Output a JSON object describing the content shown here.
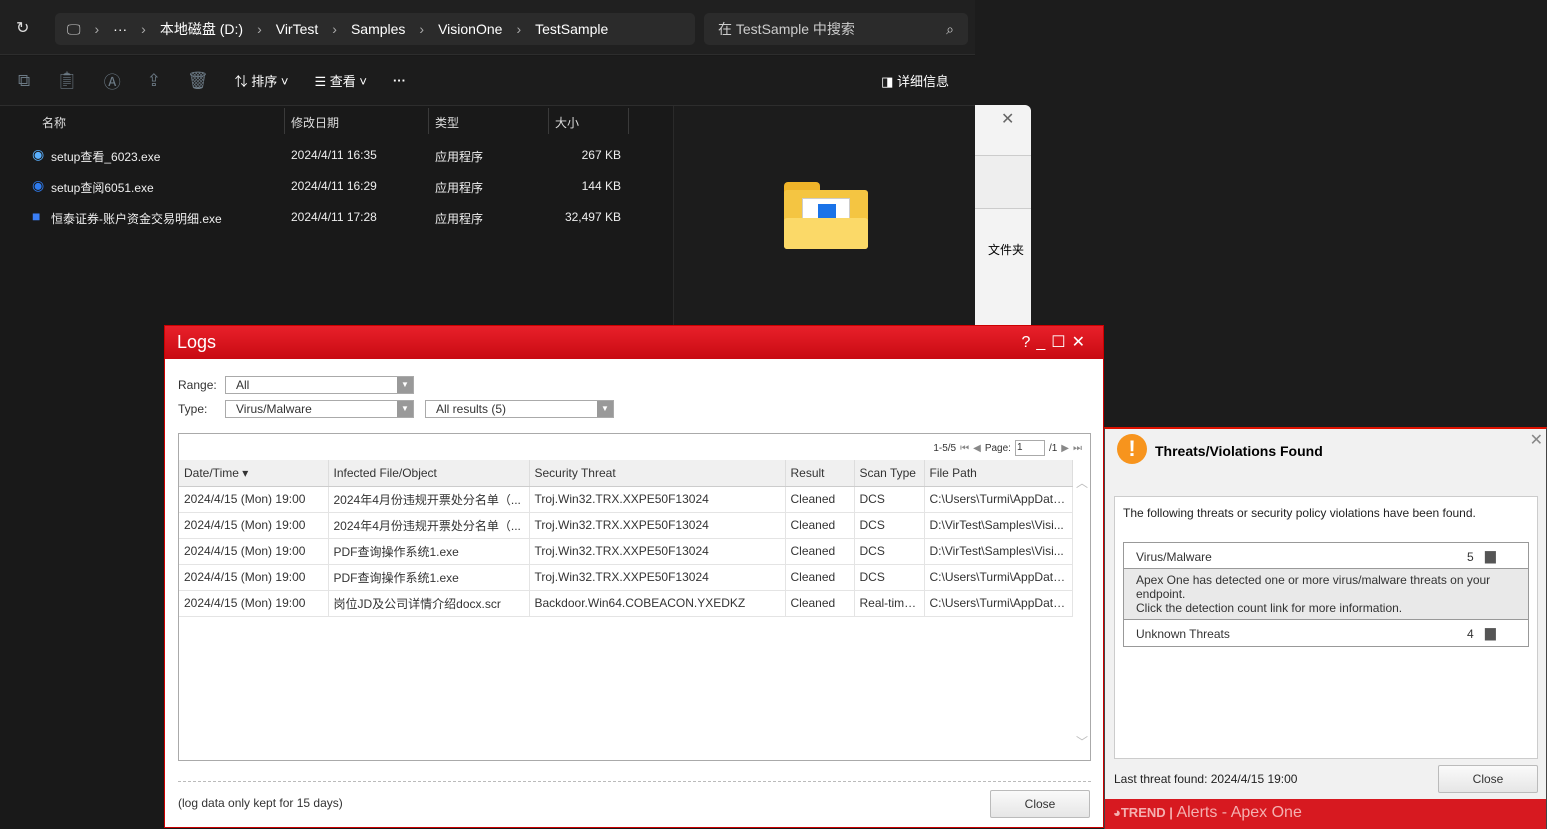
{
  "explorer": {
    "breadcrumb": [
      "本地磁盘 (D:)",
      "VirTest",
      "Samples",
      "VisionOne",
      "TestSample"
    ],
    "more": "···",
    "search_placeholder": "在 TestSample 中搜索",
    "toolbar": {
      "sort": "排序",
      "view": "查看",
      "more": "···",
      "details": "详细信息"
    },
    "columns": [
      "名称",
      "修改日期",
      "类型",
      "大小"
    ],
    "files": [
      {
        "name": "setup查看_6023.exe",
        "date": "2024/4/11 16:35",
        "type": "应用程序",
        "size": "267 KB"
      },
      {
        "name": "setup查阅6051.exe",
        "date": "2024/4/11 16:29",
        "type": "应用程序",
        "size": "144 KB"
      },
      {
        "name": "恒泰证券-账户资金交易明细.exe",
        "date": "2024/4/11 17:28",
        "type": "应用程序",
        "size": "32,497 KB"
      }
    ],
    "side_window_label": "文件夹"
  },
  "logs": {
    "title": "Logs",
    "range_label": "Range:",
    "range_value": "All",
    "type_label": "Type:",
    "type_value": "Virus/Malware",
    "results_value": "All results (5)",
    "pager": {
      "count": "1-5/5",
      "page_label": "Page:",
      "page": "1",
      "total": "/1"
    },
    "columns": [
      "Date/Time ▾",
      "Infected File/Object",
      "Security Threat",
      "Result",
      "Scan Type",
      "File Path"
    ],
    "rows": [
      [
        "2024/4/15 (Mon) 19:00",
        "2024年4月份违规开票处分名单（...",
        "Troj.Win32.TRX.XXPE50F13024",
        "Cleaned",
        "DCS",
        "C:\\Users\\Turmi\\AppData..."
      ],
      [
        "2024/4/15 (Mon) 19:00",
        "2024年4月份违规开票处分名单（...",
        "Troj.Win32.TRX.XXPE50F13024",
        "Cleaned",
        "DCS",
        "D:\\VirTest\\Samples\\Visi..."
      ],
      [
        "2024/4/15 (Mon) 19:00",
        "PDF查询操作系统1.exe",
        "Troj.Win32.TRX.XXPE50F13024",
        "Cleaned",
        "DCS",
        "D:\\VirTest\\Samples\\Visi..."
      ],
      [
        "2024/4/15 (Mon) 19:00",
        "PDF查询操作系统1.exe",
        "Troj.Win32.TRX.XXPE50F13024",
        "Cleaned",
        "DCS",
        "C:\\Users\\Turmi\\AppData..."
      ],
      [
        "2024/4/15 (Mon) 19:00",
        "岗位JD及公司详情介绍docx.scr",
        "Backdoor.Win64.COBEACON.YXEDKZ",
        "Cleaned",
        "Real-time...",
        "C:\\Users\\Turmi\\AppData..."
      ]
    ],
    "footer_note": "(log data only kept for 15 days)",
    "close": "Close"
  },
  "alert": {
    "title": "Threats/Violations Found",
    "intro": "The following threats or security policy violations have been found.",
    "items": [
      {
        "label": "Virus/Malware",
        "count": "5",
        "desc1": "Apex One has detected one or more virus/malware threats on your endpoint.",
        "desc2": "Click the detection count link for more information."
      },
      {
        "label": "Unknown Threats",
        "count": "4"
      }
    ],
    "last_found": "Last threat found: 2024/4/15 19:00",
    "close": "Close",
    "brand": "TREND",
    "footer": "Alerts - Apex One"
  }
}
